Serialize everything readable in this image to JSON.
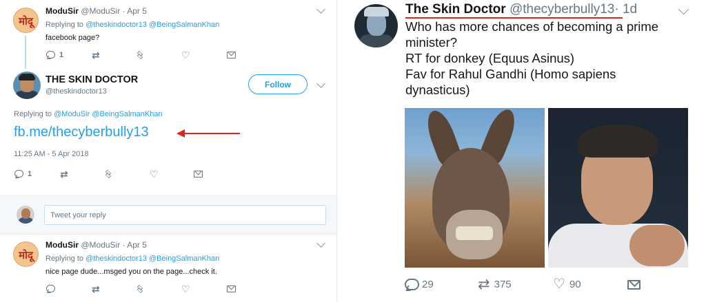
{
  "left": {
    "tweet1": {
      "name": "ModuSir",
      "handle": "@ModuSir",
      "dot": "·",
      "time": "Apr 5",
      "replying_prefix": "Replying to",
      "mention1": "@theskindoctor13",
      "mention2": "@BeingSalmanKhan",
      "text": "facebook page?",
      "reply_count": "1",
      "avatar_glyph": "मोदू"
    },
    "main_tweet": {
      "name": "THE SKIN DOCTOR",
      "handle": "@theskindoctor13",
      "follow_label": "Follow",
      "replying_prefix": "Replying to",
      "mention1": "@ModuSir",
      "mention2": "@BeingSalmanKhan",
      "link_text": "fb.me/thecyberbully13",
      "timestamp": "11:25 AM - 5 Apr 2018",
      "reply_count": "1"
    },
    "reply_box": {
      "placeholder": "Tweet your reply"
    },
    "tweet3": {
      "name": "ModuSir",
      "handle": "@ModuSir",
      "dot": "·",
      "time": "Apr 5",
      "replying_prefix": "Replying to",
      "mention1": "@theskindoctor13",
      "mention2": "@BeingSalmanKhan",
      "text": "nice page dude...msged you on the page...check it.",
      "avatar_glyph": "मोदू"
    }
  },
  "right": {
    "name": "The Skin Doctor",
    "handle": "@thecyberbully13",
    "dot": "·",
    "time": "1d",
    "text_lines": [
      "Who has more chances of becoming a prime",
      "minister?",
      "RT for donkey (Equus Asinus)",
      "Fav for Rahul Gandhi (Homo sapiens",
      "dynasticus)"
    ],
    "reply_count": "29",
    "retweet_count": "375",
    "like_count": "90"
  },
  "colors": {
    "accent": "#1da1f2",
    "annotation_red": "#e0241a",
    "muted": "#657786"
  }
}
